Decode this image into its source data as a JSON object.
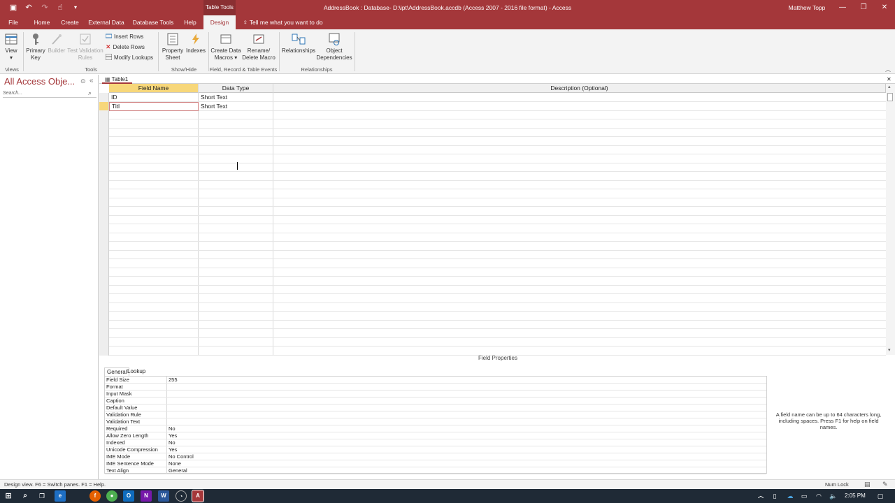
{
  "titlebar": {
    "contextual_group": "Table Tools",
    "window_title": "AddressBook : Database- D:\\ipt\\AddressBook.accdb (Access 2007 - 2016 file format)  -  Access",
    "user": "Matthew Topp"
  },
  "tabs": {
    "file": "File",
    "home": "Home",
    "create": "Create",
    "external": "External Data",
    "dbtools": "Database Tools",
    "help": "Help",
    "design": "Design",
    "tell_me": "Tell me what you want to do"
  },
  "ribbon": {
    "view": "View",
    "primary_key_1": "Primary",
    "primary_key_2": "Key",
    "builder": "Builder",
    "test_val_1": "Test Validation",
    "test_val_2": "Rules",
    "insert_rows": "Insert Rows",
    "delete_rows": "Delete Rows",
    "modify_lookups": "Modify Lookups",
    "prop_sheet_1": "Property",
    "prop_sheet_2": "Sheet",
    "indexes": "Indexes",
    "create_macros_1": "Create Data",
    "create_macros_2": "Macros",
    "rename_macro_1": "Rename/",
    "rename_macro_2": "Delete Macro",
    "relationships": "Relationships",
    "obj_dep_1": "Object",
    "obj_dep_2": "Dependencies",
    "grp_views": "Views",
    "grp_tools": "Tools",
    "grp_showhide": "Show/Hide",
    "grp_events": "Field, Record & Table Events",
    "grp_relationships": "Relationships"
  },
  "nav": {
    "title": "All Access Obje...",
    "search_placeholder": "Search..."
  },
  "document": {
    "tab": "Table1",
    "headers": [
      "Field Name",
      "Data Type",
      "Description (Optional)"
    ],
    "rows": [
      {
        "field": "ID",
        "type": "Short Text",
        "desc": ""
      },
      {
        "field": "Titl",
        "type": "Short Text",
        "desc": ""
      }
    ]
  },
  "field_properties": {
    "title": "Field Properties",
    "tab_general": "General",
    "tab_lookup": "Lookup",
    "rows": [
      {
        "label": "Field Size",
        "value": "255"
      },
      {
        "label": "Format",
        "value": ""
      },
      {
        "label": "Input Mask",
        "value": ""
      },
      {
        "label": "Caption",
        "value": ""
      },
      {
        "label": "Default Value",
        "value": ""
      },
      {
        "label": "Validation Rule",
        "value": ""
      },
      {
        "label": "Validation Text",
        "value": ""
      },
      {
        "label": "Required",
        "value": "No"
      },
      {
        "label": "Allow Zero Length",
        "value": "Yes"
      },
      {
        "label": "Indexed",
        "value": "No"
      },
      {
        "label": "Unicode Compression",
        "value": "Yes"
      },
      {
        "label": "IME Mode",
        "value": "No Control"
      },
      {
        "label": "IME Sentence Mode",
        "value": "None"
      },
      {
        "label": "Text Align",
        "value": "General"
      }
    ],
    "help": "A field name can be up to 64 characters long, including spaces. Press F1 for help on field names."
  },
  "status": {
    "left": "Design view.  F6 = Switch panes.  F1 = Help.",
    "numlock": "Num Lock"
  },
  "taskbar": {
    "clock": "2:05 PM"
  },
  "colors": {
    "brand": "#a4373a",
    "taskbar": "#1f2a36"
  }
}
